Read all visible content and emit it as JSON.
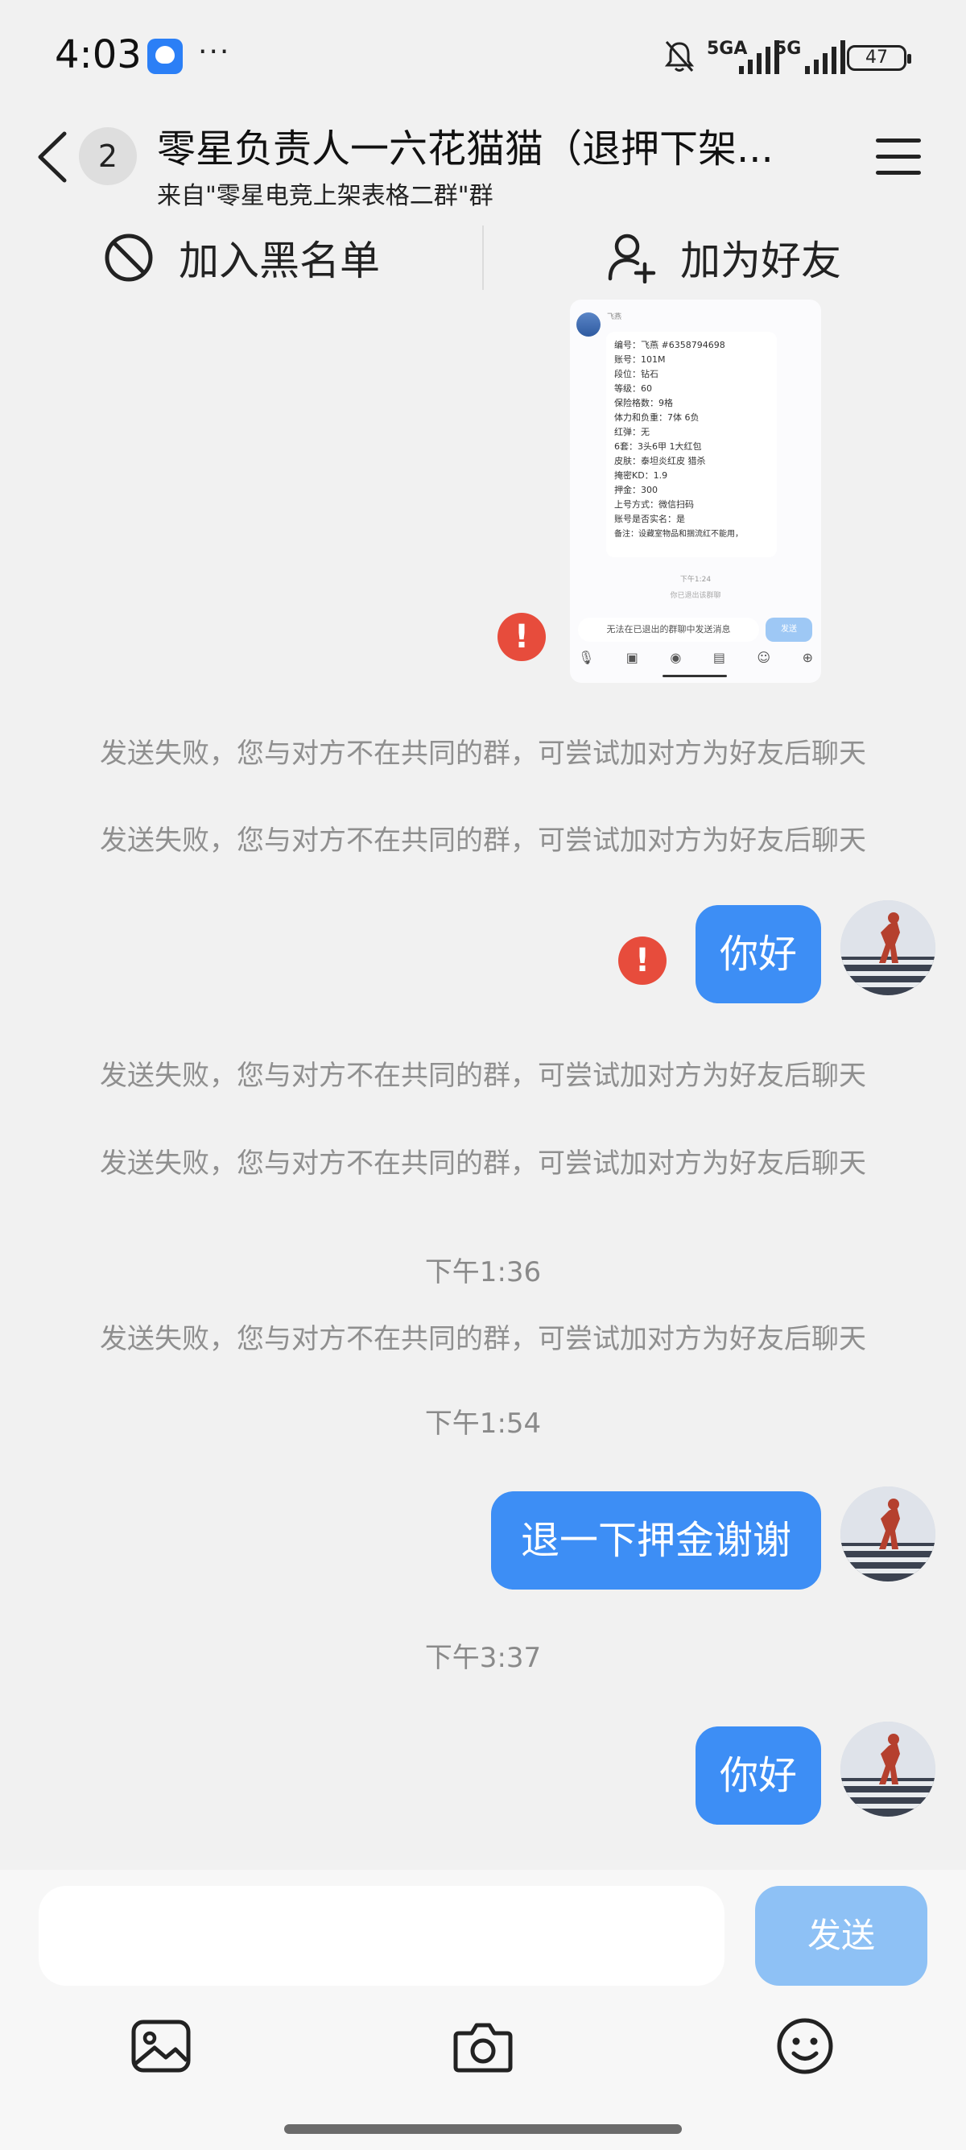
{
  "status_bar": {
    "time": "4:03",
    "more": "···",
    "net1": "5GA",
    "net2": "5G",
    "battery": "47"
  },
  "header": {
    "back_badge": "2",
    "title": "零星负责人一六花猫猫（退押下架...",
    "subtitle": "来自\"零星电竞上架表格二群\"群"
  },
  "actions": {
    "block": "加入黑名单",
    "add_friend": "加为好友"
  },
  "screenshot": {
    "sender": "飞燕",
    "lines": [
      "编号：飞燕  #6358794698",
      "账号：101M",
      "段位：钻石",
      "等级：60",
      "保险格数：9格",
      "体力和负重：7体 6负",
      "红弹：无",
      "6套：3头6甲 1大红包",
      "皮肤：泰坦炎红皮  猎杀",
      "掩密KD：1.9",
      "押金：300",
      "上号方式：微信扫码",
      "账号是否实名：是",
      "备注：设藏室物品和捆流红不能用，"
    ],
    "time": "下午1:24",
    "note": "你已退出该群聊",
    "input": "无法在已退出的群聊中发送消息",
    "send": "发送"
  },
  "messages": {
    "fail_text": "发送失败，您与对方不在共同的群，可尝试加对方为好友后聊天",
    "hello": "你好",
    "time1": "下午1:36",
    "time2": "下午1:54",
    "refund": "退一下押金谢谢",
    "time3": "下午3:37",
    "hello2": "你好",
    "error": "!"
  },
  "composer": {
    "placeholder": "",
    "send": "发送"
  },
  "colors": {
    "bubble": "#3d8ef5",
    "error": "#e74c3c",
    "send_disabled": "#8ec1f5"
  }
}
